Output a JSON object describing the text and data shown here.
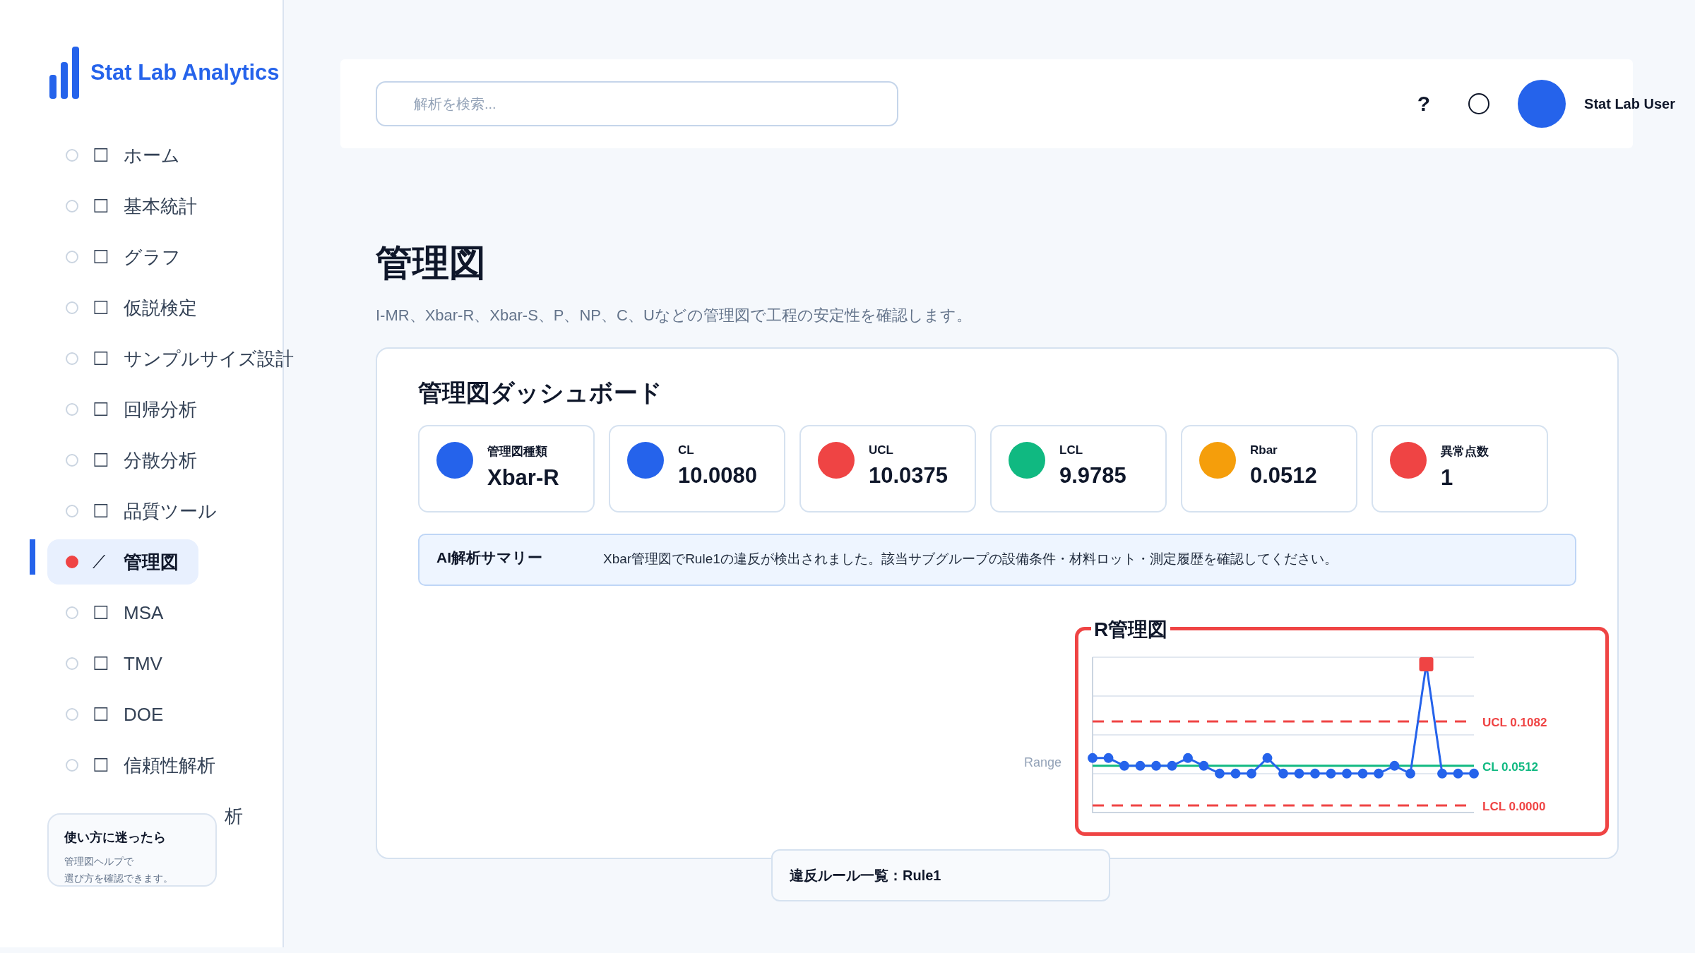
{
  "brand": {
    "name": "Stat Lab Analytics"
  },
  "nav": [
    {
      "icon": "☐",
      "label": "ホーム",
      "selected": false
    },
    {
      "icon": "☐",
      "label": "基本統計",
      "selected": false
    },
    {
      "icon": "☐",
      "label": "グラフ",
      "selected": false
    },
    {
      "icon": "☐",
      "label": "仮説検定",
      "selected": false
    },
    {
      "icon": "☐",
      "label": "サンプルサイズ設計",
      "selected": false
    },
    {
      "icon": "☐",
      "label": "回帰分析",
      "selected": false
    },
    {
      "icon": "☐",
      "label": "分散分析",
      "selected": false
    },
    {
      "icon": "☐",
      "label": "品質ツール",
      "selected": false
    },
    {
      "icon": "⟋",
      "label": "管理図",
      "selected": true
    },
    {
      "icon": "☐",
      "label": "MSA",
      "selected": false
    },
    {
      "icon": "☐",
      "label": "TMV",
      "selected": false
    },
    {
      "icon": "☐",
      "label": "DOE",
      "selected": false
    },
    {
      "icon": "☐",
      "label": "信頼性解析",
      "selected": false
    },
    {
      "label": "析",
      "selected": false
    }
  ],
  "help": {
    "title": "使い方に迷ったら",
    "lines": [
      "管理図ヘルプで",
      "選び方を確認できます。"
    ]
  },
  "header": {
    "search_placeholder": "解析を検索...",
    "help": "?",
    "user": "Stat Lab User"
  },
  "page": {
    "title": "管理図",
    "subtitle": "I-MR、Xbar-R、Xbar-S、P、NP、C、Uなどの管理図で工程の安定性を確認します。"
  },
  "dashboard": {
    "title": "管理図ダッシュボード",
    "stats": [
      {
        "label": "管理図種類",
        "value": "Xbar-R",
        "color": "#2563eb"
      },
      {
        "label": "CL",
        "value": "10.0080",
        "color": "#2563eb"
      },
      {
        "label": "UCL",
        "value": "10.0375",
        "color": "#ef4444"
      },
      {
        "label": "LCL",
        "value": "9.9785",
        "color": "#10b981"
      },
      {
        "label": "Rbar",
        "value": "0.0512",
        "color": "#f59e0b"
      },
      {
        "label": "異常点数",
        "value": "1",
        "color": "#ef4444"
      }
    ],
    "summary": {
      "title": "AI解析サマリー",
      "text": "Xbar管理図でRule1の違反が検出されました。該当サブグループの設備条件・材料ロット・測定履歴を確認してください。"
    },
    "chart": {
      "title": "R管理図",
      "axis_label": "Range",
      "limits": [
        {
          "kind": "upper",
          "label": "UCL 0.1082",
          "color": "#ef4444"
        },
        {
          "kind": "center",
          "label": "CL 0.0512",
          "color": "#10b981"
        },
        {
          "kind": "lower",
          "label": "LCL 0.0000",
          "color": "#ef4444"
        }
      ]
    },
    "violations": "違反ルール一覧：Rule1"
  }
}
